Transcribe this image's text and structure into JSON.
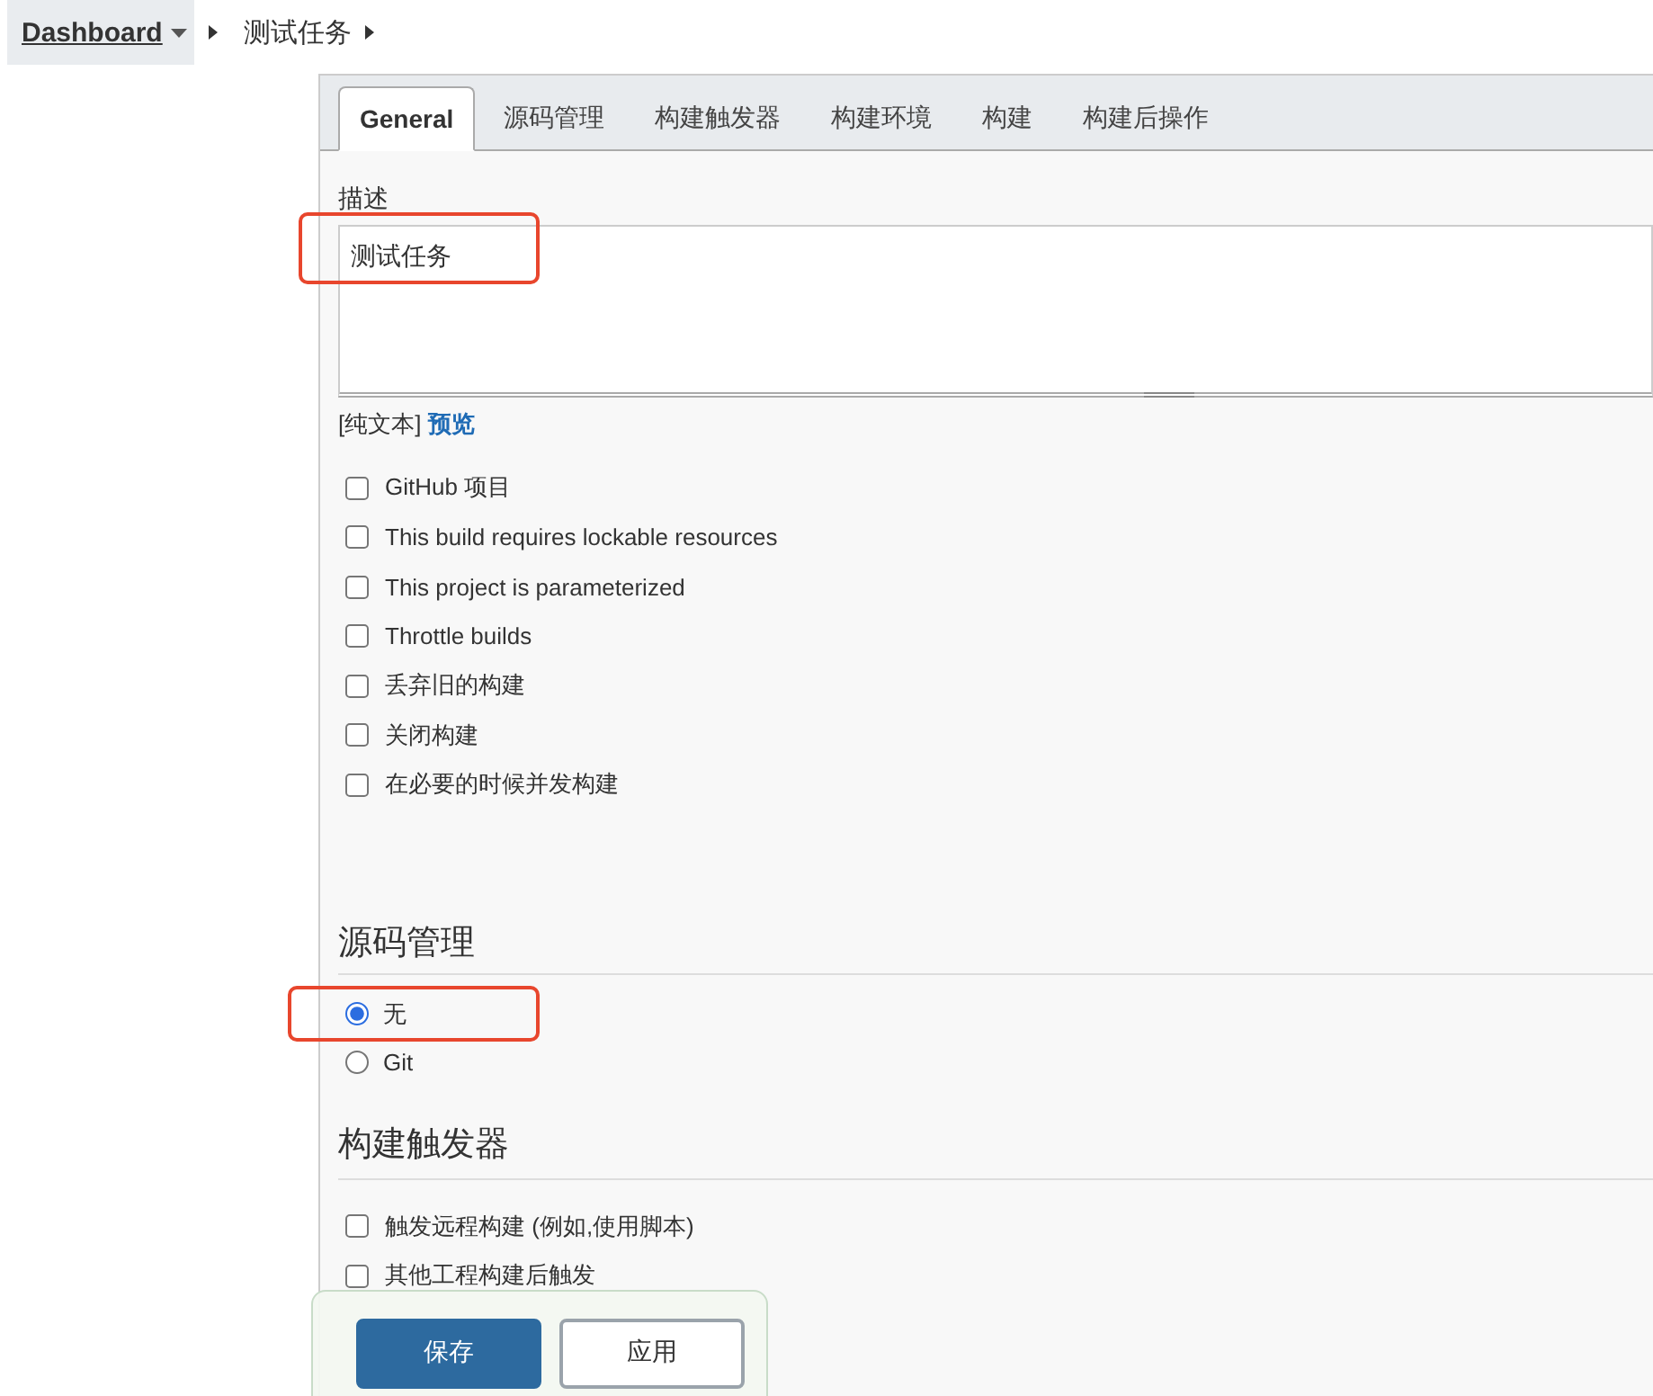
{
  "breadcrumb": [
    {
      "label": "Dashboard",
      "kind": "link"
    },
    {
      "label": "测试任务",
      "kind": "text"
    }
  ],
  "tabs": [
    {
      "label": "General",
      "selected": true
    },
    {
      "label": "源码管理",
      "selected": false
    },
    {
      "label": "构建触发器",
      "selected": false
    },
    {
      "label": "构建环境",
      "selected": false
    },
    {
      "label": "构建",
      "selected": false
    },
    {
      "label": "构建后操作",
      "selected": false
    }
  ],
  "description": {
    "label": "描述",
    "value": "测试任务",
    "format": "[纯文本]",
    "preview_link": "预览"
  },
  "general_options": [
    {
      "label": "GitHub 项目",
      "checked": false
    },
    {
      "label": "This build requires lockable resources",
      "checked": false
    },
    {
      "label": "This project is parameterized",
      "checked": false
    },
    {
      "label": "Throttle builds",
      "checked": false
    },
    {
      "label": "丢弃旧的构建",
      "checked": false
    },
    {
      "label": "关闭构建",
      "checked": false
    },
    {
      "label": "在必要的时候并发构建",
      "checked": false
    }
  ],
  "scm": {
    "title": "源码管理",
    "options": [
      {
        "label": "无",
        "selected": true
      },
      {
        "label": "Git",
        "selected": false
      }
    ]
  },
  "triggers": {
    "title": "构建触发器",
    "options": [
      {
        "label": "触发远程构建 (例如,使用脚本)",
        "checked": false
      },
      {
        "label": "其他工程构建后触发",
        "checked": false
      }
    ]
  },
  "buttons": [
    {
      "label": "保存",
      "kind": "primary"
    },
    {
      "label": "应用",
      "kind": "secondary"
    }
  ]
}
